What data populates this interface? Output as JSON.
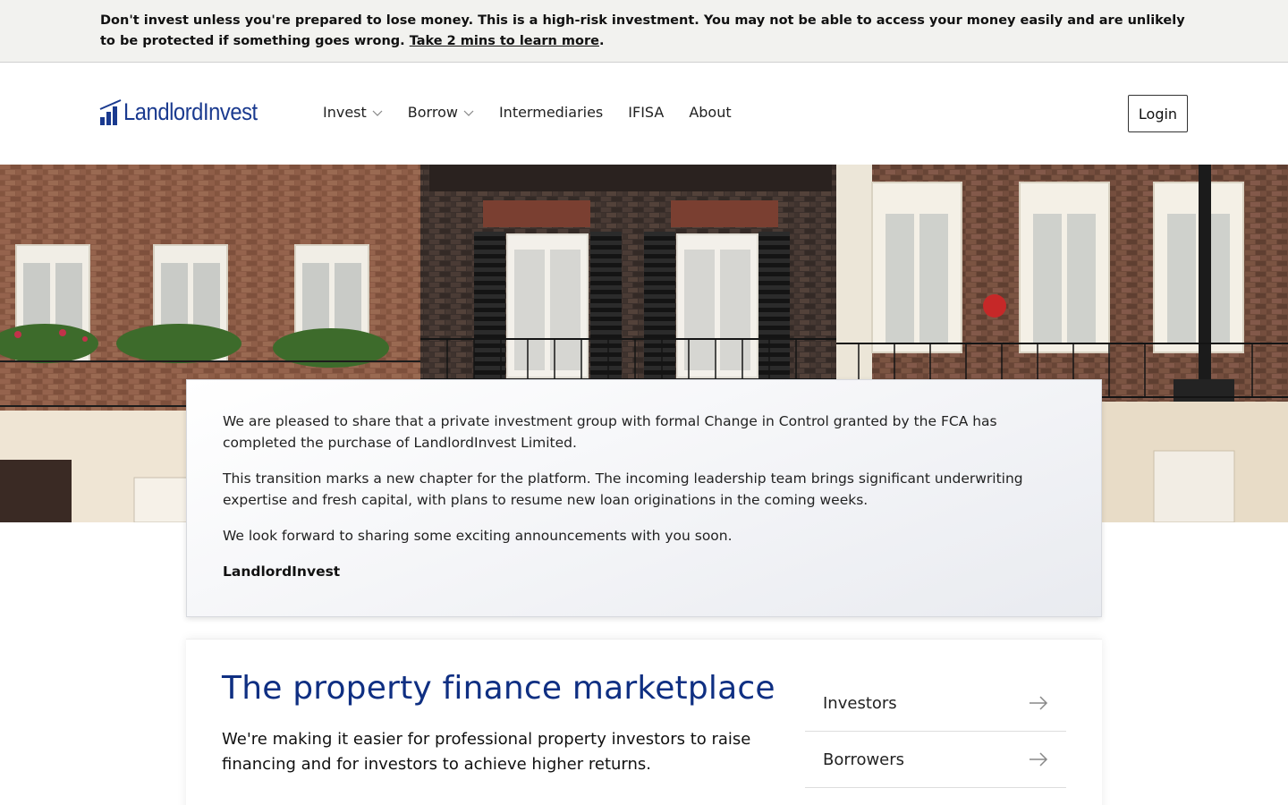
{
  "risk_banner": {
    "text": "Don't invest unless you're prepared to lose money. This is a high-risk investment. You may not be able to access your money easily and are unlikely to be protected if something goes wrong. ",
    "link_text": "Take 2 mins to learn more",
    "suffix": "."
  },
  "header": {
    "logo_text": "LandlordInvest",
    "brand_color": "#1a3a8f",
    "nav": [
      {
        "label": "Invest",
        "has_dropdown": true
      },
      {
        "label": "Borrow",
        "has_dropdown": true
      },
      {
        "label": "Intermediaries",
        "has_dropdown": false
      },
      {
        "label": "IFISA",
        "has_dropdown": false
      },
      {
        "label": "About",
        "has_dropdown": false
      }
    ],
    "login_label": "Login"
  },
  "announcement": {
    "paragraphs": [
      "We are pleased to share that a private investment group with formal Change in Control granted by the FCA has completed the purchase of LandlordInvest Limited.",
      "This transition marks a new chapter for the platform. The incoming leadership team brings significant underwriting expertise and fresh capital, with plans to resume new loan originations in the coming weeks.",
      "We look forward to sharing some exciting announcements with you soon."
    ],
    "signature": "LandlordInvest"
  },
  "marketplace": {
    "title": "The property finance marketplace",
    "title_color": "#0f2f82",
    "subtitle": "We're making it easier for professional property investors to raise financing and for investors to achieve higher returns.",
    "audiences": [
      {
        "label": "Investors",
        "icon": "arrow-right-icon"
      },
      {
        "label": "Borrowers",
        "icon": "arrow-right-icon"
      }
    ]
  }
}
